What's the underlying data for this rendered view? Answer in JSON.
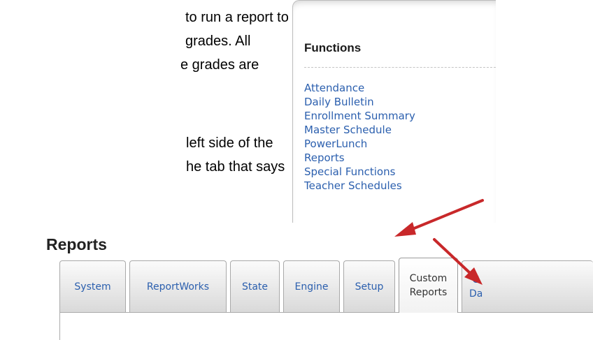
{
  "document": {
    "lines": [
      "to run a report to",
      " grades.  All",
      "e grades are",
      "left side of the",
      "he tab that says"
    ]
  },
  "functions_panel": {
    "title": "Functions",
    "items": [
      "Attendance",
      "Daily Bulletin",
      "Enrollment Summary",
      "Master Schedule",
      "PowerLunch",
      "Reports",
      "Special Functions",
      "Teacher Schedules"
    ]
  },
  "reports_page": {
    "heading": "Reports",
    "tabs": [
      {
        "label": "System"
      },
      {
        "label": "ReportWorks"
      },
      {
        "label": "State"
      },
      {
        "label": "Engine"
      },
      {
        "label": "Setup"
      },
      {
        "label": "Custom Reports",
        "active": true
      },
      {
        "label": "C Da",
        "partial": true
      }
    ]
  },
  "colors": {
    "link": "#2b5fae",
    "arrow": "#c8282a",
    "heading": "#222222"
  },
  "icons": {
    "arrow_to_reports": "red-arrow-icon",
    "arrow_to_custom_reports": "red-arrow-icon"
  }
}
